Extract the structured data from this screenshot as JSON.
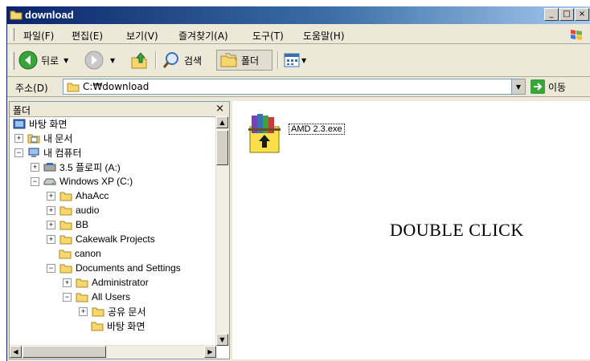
{
  "window": {
    "title": "download"
  },
  "menu": {
    "items": [
      "파일(F)",
      "편집(E)",
      "보기(V)",
      "즐겨찾기(A)",
      "도구(T)",
      "도움말(H)"
    ]
  },
  "toolbar": {
    "back_label": "뒤로",
    "search_label": "검색",
    "folders_label": "폴더"
  },
  "address": {
    "label": "주소(D)",
    "value": "C:₩download",
    "go_label": "이동"
  },
  "folders_pane": {
    "title": "폴더",
    "close": "×",
    "tree": [
      {
        "label": "바탕 화면"
      },
      {
        "label": "내 문서",
        "expander": "+"
      },
      {
        "label": "내 컴퓨터",
        "expander": "−"
      },
      {
        "label": "3.5 플로피 (A:)",
        "expander": "+"
      },
      {
        "label": "Windows XP (C:)",
        "expander": "−"
      },
      {
        "label": "AhaAcc",
        "expander": "+"
      },
      {
        "label": "audio",
        "expander": "+"
      },
      {
        "label": "BB",
        "expander": "+"
      },
      {
        "label": "Cakewalk Projects",
        "expander": "+"
      },
      {
        "label": "canon"
      },
      {
        "label": "Documents and Settings",
        "expander": "−"
      },
      {
        "label": "Administrator",
        "expander": "+"
      },
      {
        "label": "All Users",
        "expander": "−"
      },
      {
        "label": "공유 문서",
        "expander": "+"
      },
      {
        "label": "바탕 화면"
      }
    ]
  },
  "files": [
    {
      "name": "AMD 2.3.exe",
      "icon": "winrar-archive-icon"
    }
  ],
  "annotation": {
    "text": "DOUBLE CLICK",
    "arrow_color": "#e8201a"
  }
}
